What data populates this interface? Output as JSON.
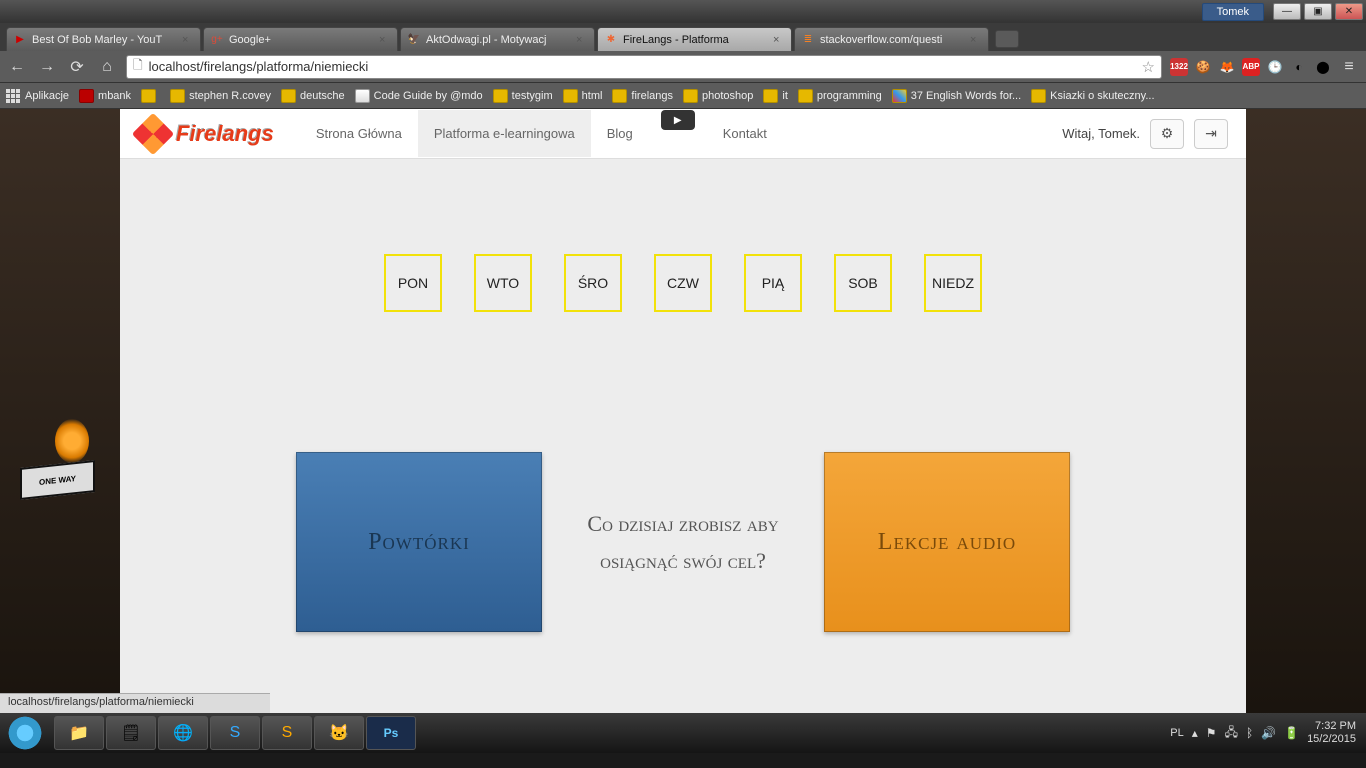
{
  "win": {
    "user": "Tomek"
  },
  "tabs": [
    {
      "label": "Best Of Bob Marley - YouT",
      "fav": "▶",
      "favColor": "#cc0000"
    },
    {
      "label": "Google+",
      "fav": "g+",
      "favColor": "#dd4b39"
    },
    {
      "label": "AktOdwagi.pl - Motywacj",
      "fav": "🦅",
      "favColor": "#555"
    },
    {
      "label": "FireLangs - Platforma",
      "fav": "✱",
      "favColor": "#e63",
      "active": true
    },
    {
      "label": "stackoverflow.com/questi",
      "fav": "≣",
      "favColor": "#f48024"
    }
  ],
  "omnibox": {
    "url": "localhost/firelangs/platforma/niemiecki"
  },
  "ext_badge": "1322",
  "bookmarks": {
    "apps": "Aplikacje",
    "items": [
      {
        "label": "mbank",
        "cls": "mbank"
      },
      {
        "label": "",
        "cls": ""
      },
      {
        "label": "stephen R.covey",
        "cls": ""
      },
      {
        "label": "deutsche",
        "cls": ""
      },
      {
        "label": "Code Guide by @mdo",
        "cls": "mail"
      },
      {
        "label": "testygim",
        "cls": ""
      },
      {
        "label": "html",
        "cls": ""
      },
      {
        "label": "firelangs",
        "cls": ""
      },
      {
        "label": "photoshop",
        "cls": ""
      },
      {
        "label": "it",
        "cls": ""
      },
      {
        "label": "programming",
        "cls": ""
      },
      {
        "label": "37 English Words for...",
        "cls": "colorful"
      },
      {
        "label": "Ksiazki o skuteczny...",
        "cls": ""
      }
    ]
  },
  "site": {
    "brand": "Firelangs",
    "nav": {
      "home": "Strona Główna",
      "platform": "Platforma e-learningowa",
      "blog": "Blog",
      "contact": "Kontakt"
    },
    "greeting": "Witaj, Tomek."
  },
  "days": [
    "PON",
    "WTO",
    "ŚRO",
    "CZW",
    "PIĄ",
    "SOB",
    "NIEDZ"
  ],
  "cards": {
    "left": "Powtórki",
    "mid": "Co dzisiaj zrobisz aby osiągnąć swój cel?",
    "right": "Lekcje audio"
  },
  "sign": "ONE WAY",
  "statusbar": "localhost/firelangs/platforma/niemiecki",
  "tray": {
    "lang": "PL",
    "time": "7:32 PM",
    "date": "15/2/2015"
  }
}
